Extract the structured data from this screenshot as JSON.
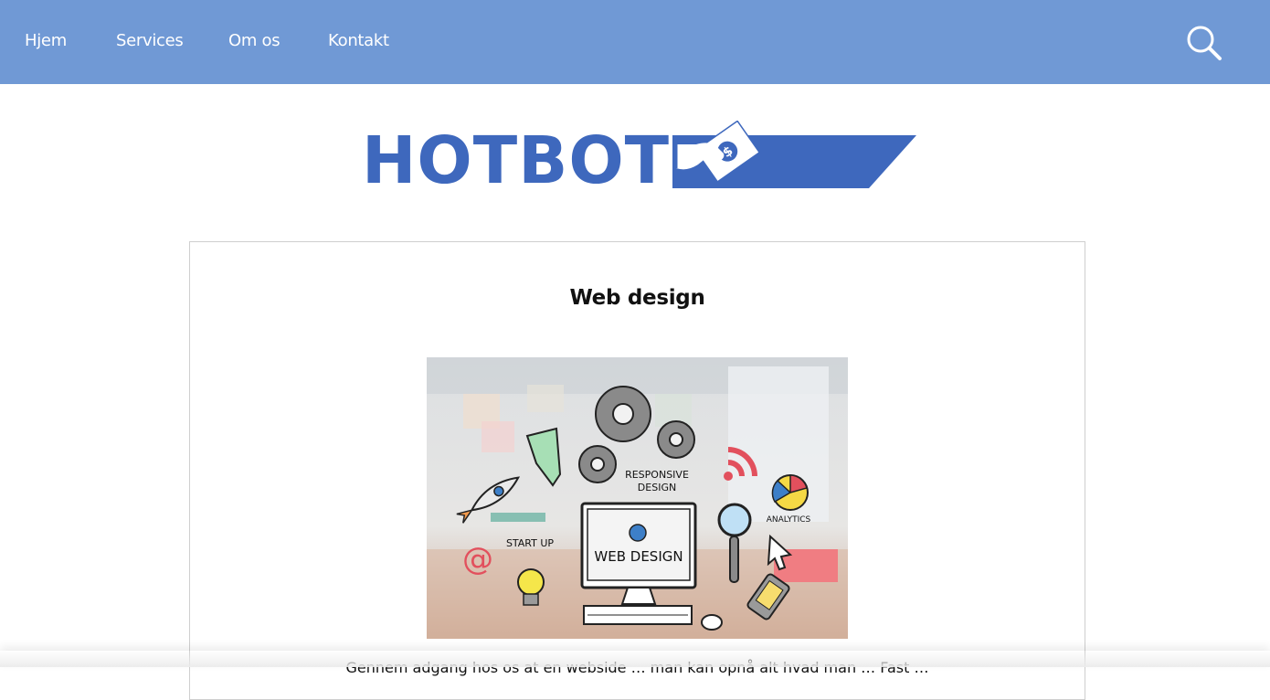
{
  "nav": {
    "items": [
      {
        "label": "Hjem"
      },
      {
        "label": "Services"
      },
      {
        "label": "Om os"
      },
      {
        "label": "Kontakt"
      }
    ],
    "search_icon": "search-icon"
  },
  "logo": {
    "text": "HOTBOT",
    "mark_icon": "hand-with-dollar-bill-icon",
    "color": "#3e68bd"
  },
  "card": {
    "title": "Web design",
    "image_labels": {
      "responsive": "RESPONSIVE",
      "design": "DESIGN",
      "analytics": "ANALYTICS",
      "start_up": "START UP",
      "web_design": "WEB DESIGN"
    },
    "body_text_partial": "Gennem adgang hos os at en webside … man kan opnå alt hvad man … Fast …"
  },
  "colors": {
    "nav_bg": "#7099d5",
    "brand_blue": "#3e68bd"
  }
}
